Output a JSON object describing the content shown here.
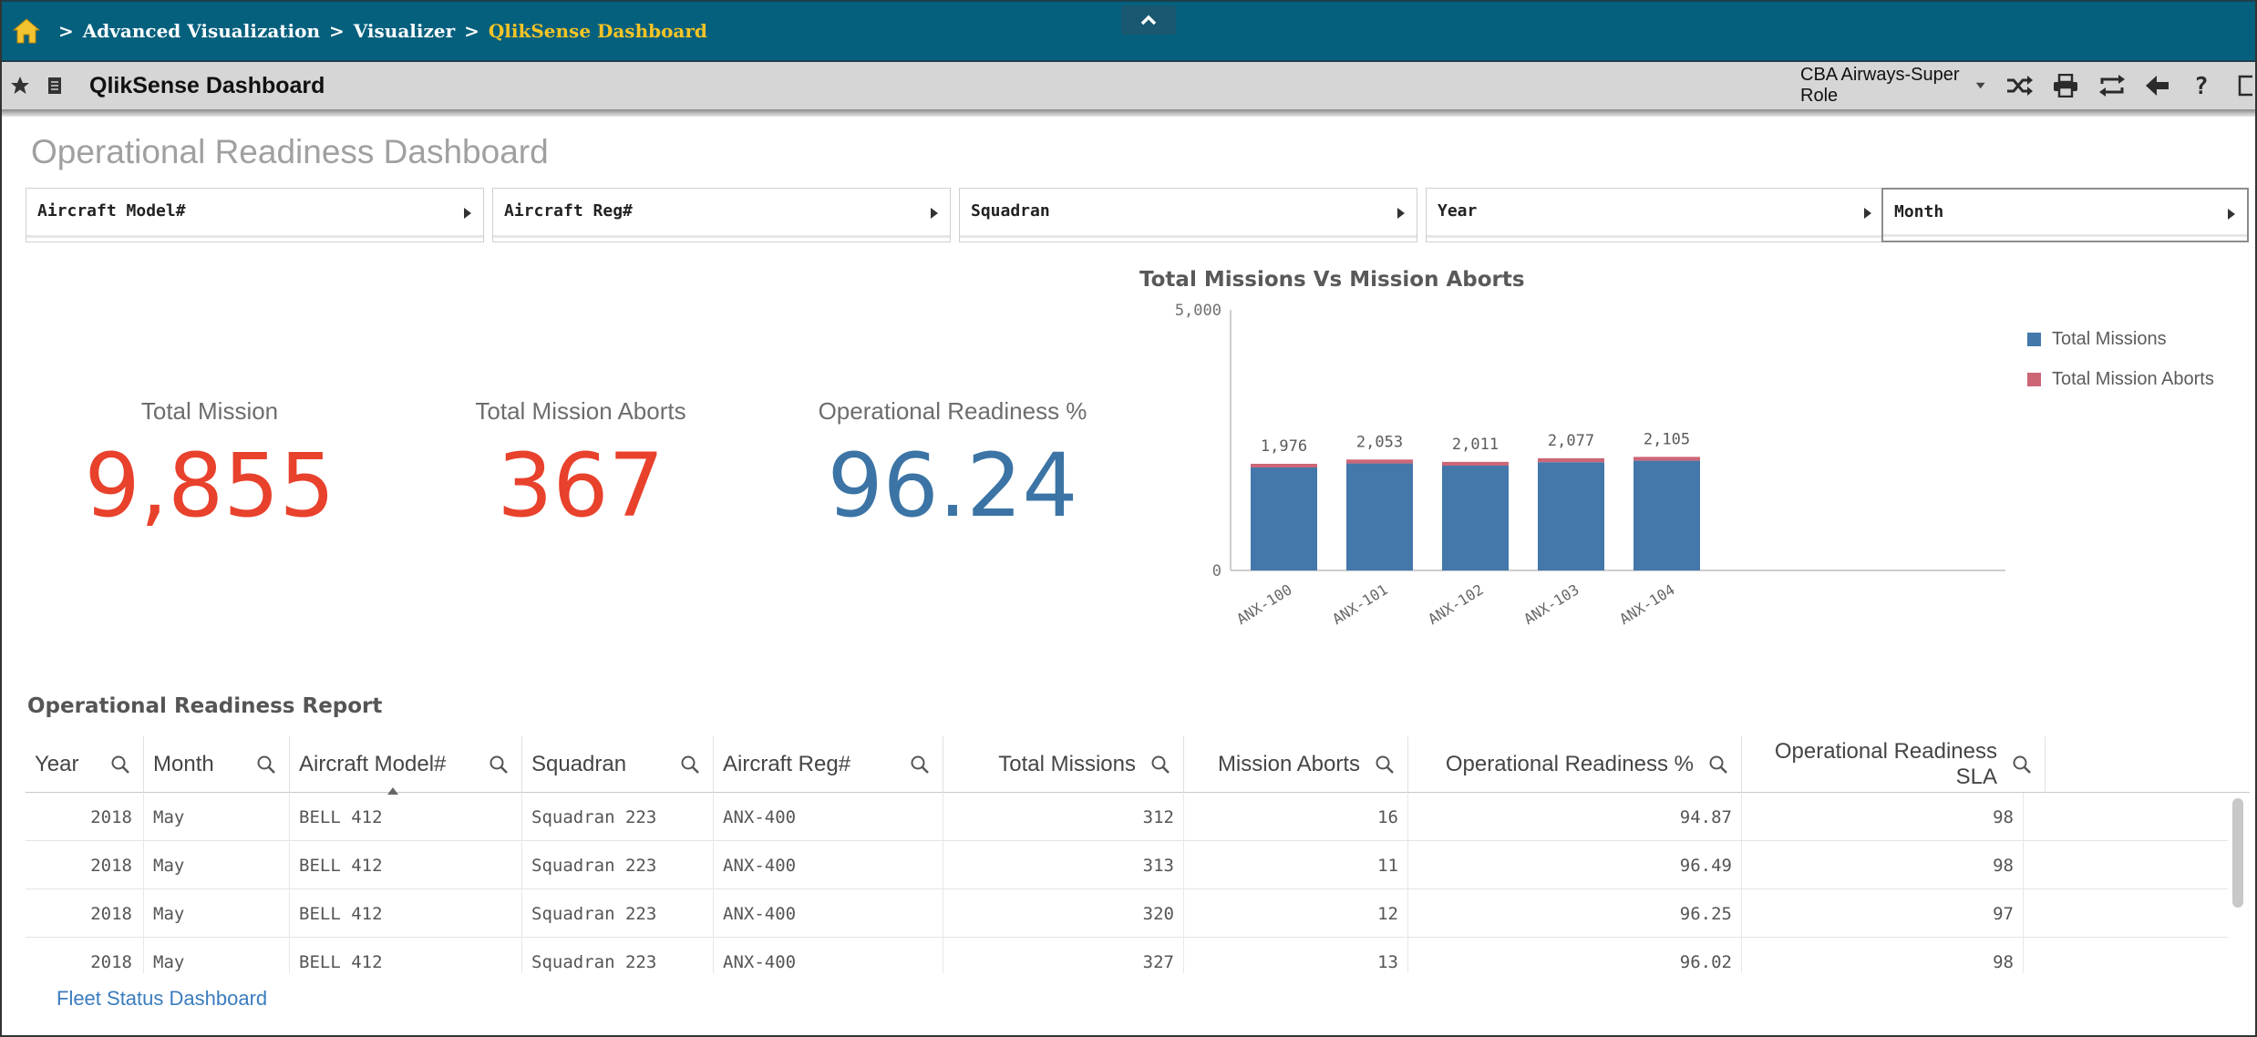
{
  "breadcrumb": {
    "items": [
      "Advanced Visualization",
      "Visualizer"
    ],
    "current": "QlikSense Dashboard",
    "separator": ">"
  },
  "toolbar": {
    "title": "QlikSense Dashboard",
    "role": "CBA Airways-Super Role",
    "icons": [
      "shuffle-icon",
      "print-icon",
      "sync-icon",
      "back-arrow-icon",
      "help-icon",
      "window-icon"
    ]
  },
  "sheet": {
    "title": "Operational Readiness Dashboard"
  },
  "filters": [
    {
      "label": "Aircraft Model#"
    },
    {
      "label": "Aircraft Reg#"
    },
    {
      "label": "Squadran"
    },
    {
      "label": "Year"
    },
    {
      "label": "Month"
    }
  ],
  "kpis": {
    "total_mission": {
      "label": "Total Mission",
      "value": "9,855",
      "color": "#e8412c"
    },
    "total_mission_aborts": {
      "label": "Total Mission Aborts",
      "value": "367",
      "color": "#e8412c"
    },
    "operational_readiness": {
      "label": "Operational Readiness %",
      "value": "96.24",
      "color": "#3b74a5"
    }
  },
  "chart_data": {
    "type": "bar",
    "title": "Total Missions Vs Mission Aborts",
    "categories": [
      "ANX-100",
      "ANX-101",
      "ANX-102",
      "ANX-103",
      "ANX-104"
    ],
    "series": [
      {
        "name": "Total Missions",
        "values": [
          1976,
          2053,
          2011,
          2077,
          2105
        ],
        "color": "#4477aa"
      },
      {
        "name": "Total Mission Aborts",
        "values": [
          70,
          75,
          72,
          76,
          74
        ],
        "color": "#cc6677"
      }
    ],
    "stacked": true,
    "totals": [
      "1,976",
      "2,053",
      "2,011",
      "2,077",
      "2,105"
    ],
    "ylim": [
      0,
      5000
    ],
    "yticks": [
      "0",
      "5,000"
    ],
    "legend_position": "right",
    "grid": false
  },
  "report": {
    "title": "Operational Readiness Report",
    "columns": [
      "Year",
      "Month",
      "Aircraft Model#",
      "Squadran",
      "Aircraft Reg#",
      "Total Missions",
      "Mission Aborts",
      "Operational Readiness %",
      "Operational Readiness SLA"
    ],
    "rows": [
      [
        "2018",
        "May",
        "BELL 412",
        "Squadran 223",
        "ANX-400",
        "312",
        "16",
        "94.87",
        "98"
      ],
      [
        "2018",
        "May",
        "BELL 412",
        "Squadran 223",
        "ANX-400",
        "313",
        "11",
        "96.49",
        "98"
      ],
      [
        "2018",
        "May",
        "BELL 412",
        "Squadran 223",
        "ANX-400",
        "320",
        "12",
        "96.25",
        "97"
      ],
      [
        "2018",
        "May",
        "BELL 412",
        "Squadran 223",
        "ANX-400",
        "327",
        "13",
        "96.02",
        "98"
      ]
    ]
  },
  "footer": {
    "link": "Fleet Status Dashboard"
  },
  "colors": {
    "topbar": "#05607d",
    "breadcrumb_current": "#f7c425",
    "toolbar": "#d6d6d6",
    "link": "#3b7cbf"
  }
}
